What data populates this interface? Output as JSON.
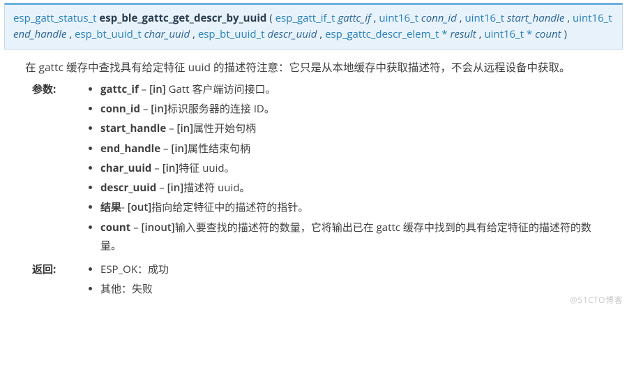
{
  "signature": {
    "return_type": "esp_gatt_status_t",
    "fn_name": "esp_ble_gattc_get_descr_by_uuid",
    "params": [
      {
        "type": "esp_gatt_if_t",
        "name": "gattc_if"
      },
      {
        "type": "uint16_t",
        "name": "conn_id"
      },
      {
        "type": "uint16_t",
        "name": "start_handle"
      },
      {
        "type": "uint16_t",
        "name": "end_handle"
      },
      {
        "type": "esp_bt_uuid_t",
        "name": "char_uuid"
      },
      {
        "type": "esp_bt_uuid_t",
        "name": "descr_uuid"
      },
      {
        "type": "esp_gattc_descr_elem_t *",
        "name": "result"
      },
      {
        "type": "uint16_t *",
        "name": "count"
      }
    ]
  },
  "description": "在 gattc 缓存中查找具有给定特征 uuid 的描述符注意：它只是从本地缓存中获取描述符，不会从远程设备中获取。",
  "labels": {
    "params": "参数:",
    "return": "返回:"
  },
  "params_doc": [
    {
      "name": "gattc_if",
      "sep": " – ",
      "dir": "[in]",
      "text": " Gatt 客户端访问接口。"
    },
    {
      "name": "conn_id",
      "sep": " – ",
      "dir": "[in]",
      "text": "标识服务器的连接 ID。"
    },
    {
      "name": "start_handle",
      "sep": " – ",
      "dir": "[in]",
      "text": "属性开始句柄"
    },
    {
      "name": "end_handle",
      "sep": " – ",
      "dir": "[in]",
      "text": "属性结束句柄"
    },
    {
      "name": "char_uuid",
      "sep": " – ",
      "dir": "[in]",
      "text": "特征 uuid。"
    },
    {
      "name": "descr_uuid",
      "sep": " – ",
      "dir": "[in]",
      "text": "描述符 uuid。"
    },
    {
      "name": "结果",
      "sep": "- ",
      "dir": "[out]",
      "text": "指向给定特征中的描述符的指针。"
    },
    {
      "name": "count",
      "sep": " – ",
      "dir": "[inout]",
      "text": "输入要查找的描述符的数量，它将输出已在 gattc 缓存中找到的具有给定特征的描述符的数量。"
    }
  ],
  "returns_doc": [
    "ESP_OK：成功",
    "其他：失败"
  ],
  "watermark": "@51CTO博客"
}
